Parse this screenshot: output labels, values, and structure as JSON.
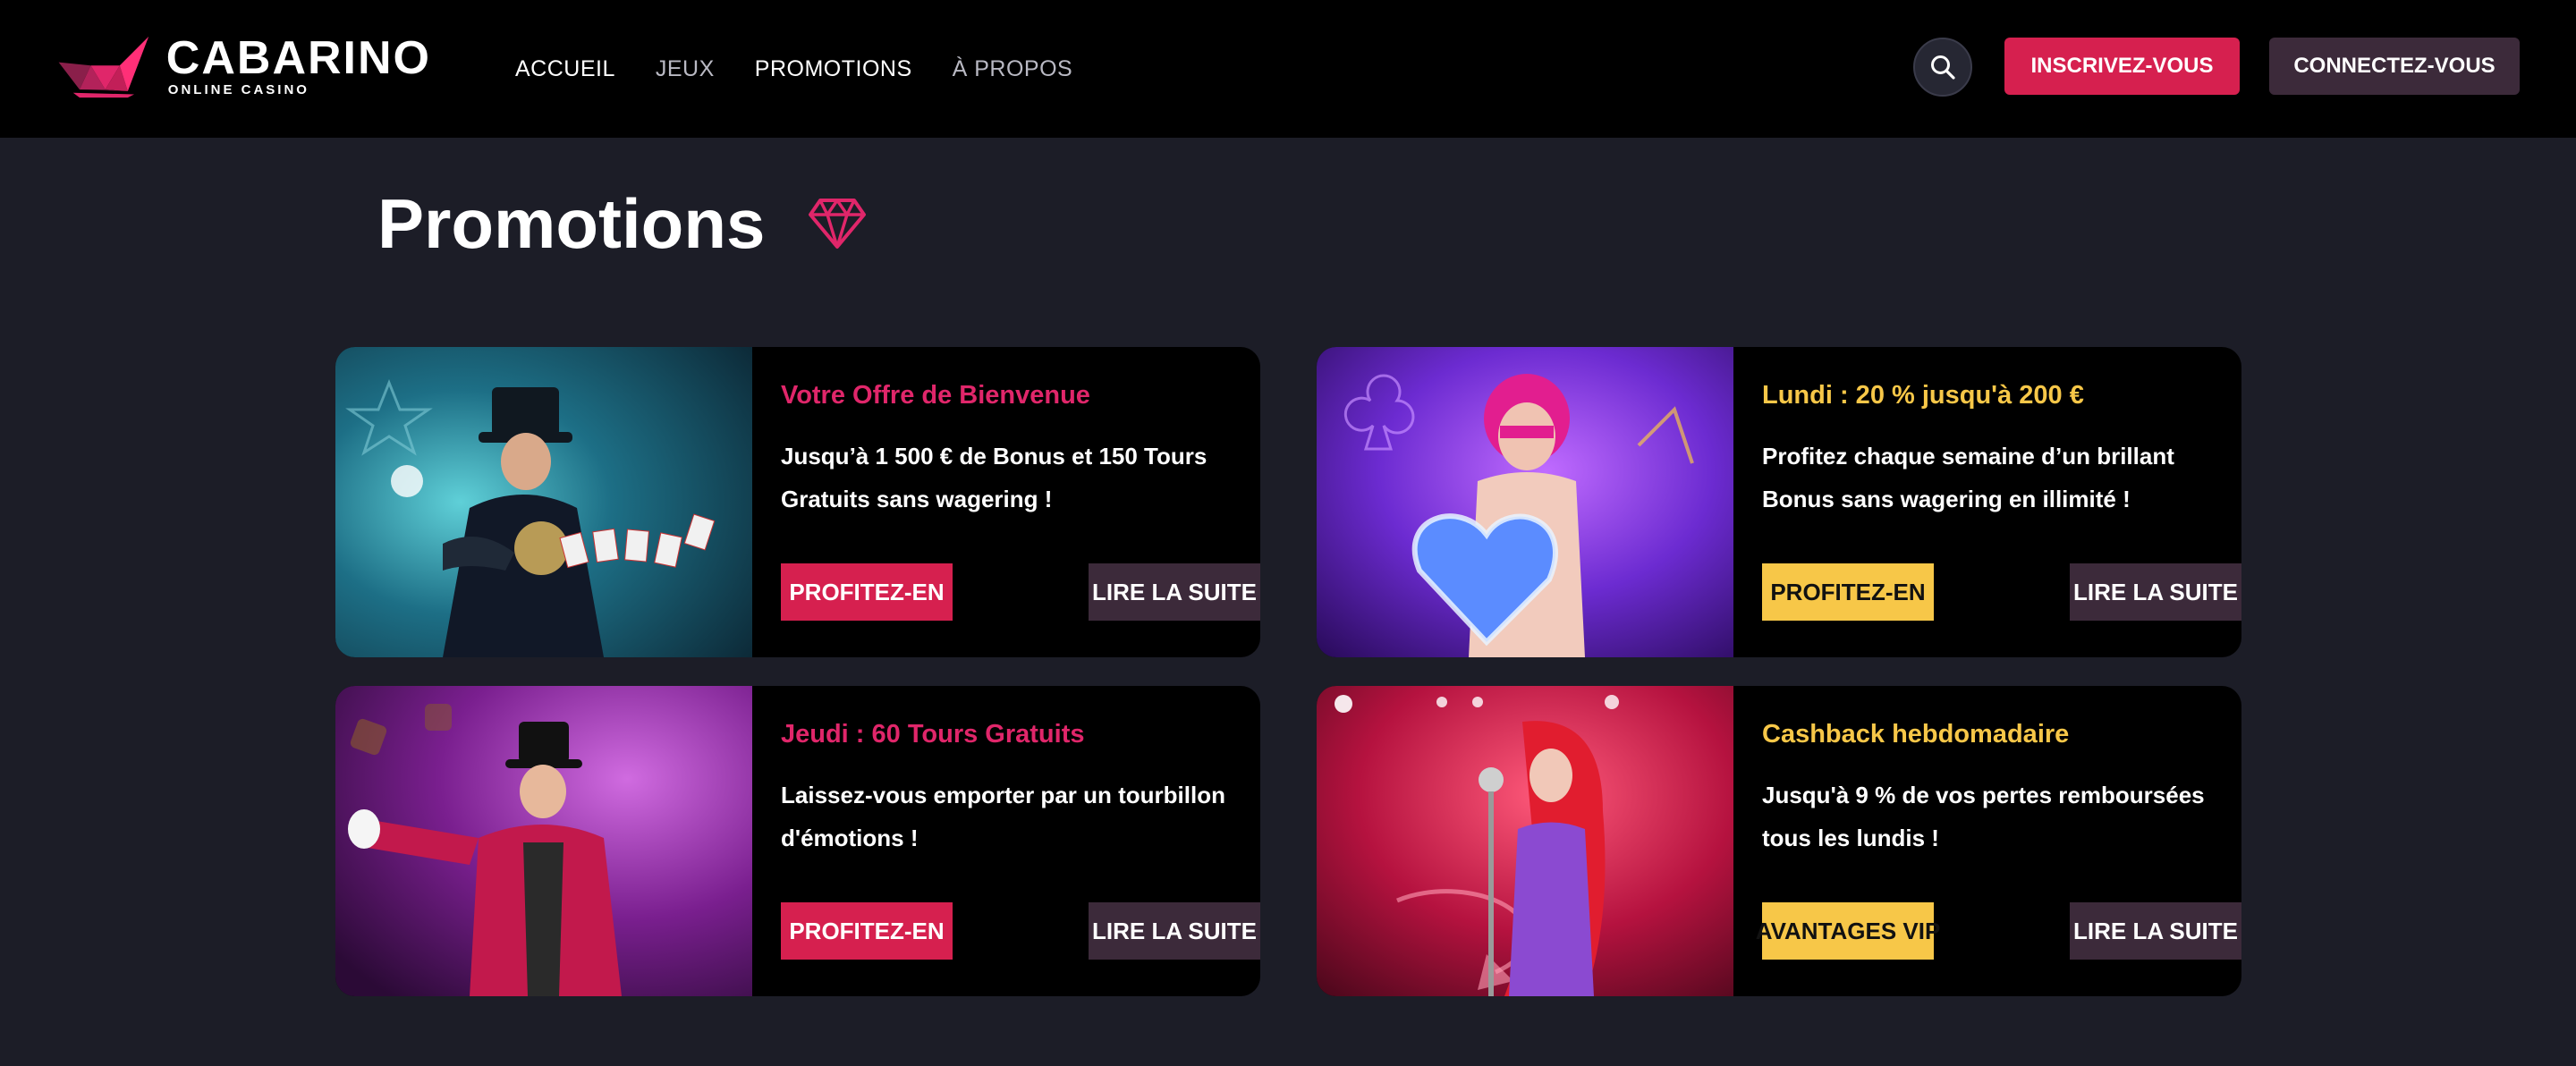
{
  "brand": {
    "name": "CABARINO",
    "tagline": "ONLINE CASINO"
  },
  "nav": {
    "items": [
      {
        "label": "ACCUEIL"
      },
      {
        "label": "JEUX"
      },
      {
        "label": "PROMOTIONS"
      },
      {
        "label": "À PROPOS"
      }
    ]
  },
  "header": {
    "register_label": "INSCRIVEZ-VOUS",
    "login_label": "CONNECTEZ-VOUS"
  },
  "page": {
    "title": "Promotions"
  },
  "colors": {
    "accent_pink": "#d6204f",
    "accent_yellow": "#f7c748",
    "secondary_button": "#3c2a3a",
    "background": "#1c1d27"
  },
  "promotions": [
    {
      "title": "Votre Offre de Bienvenue",
      "description": "Jusqu’à 1 500 € de Bonus et 150 Tours Gratuits sans wagering !",
      "cta_label": "PROFITEZ-EN",
      "more_label": "LIRE LA SUITE",
      "image": "magician-cards-image"
    },
    {
      "title": "Lundi : 20 % jusqu'à 200 €",
      "description": "Profitez chaque semaine d’un brillant Bonus sans wagering en illimité !",
      "cta_label": "PROFITEZ-EN",
      "more_label": "LIRE LA SUITE",
      "image": "woman-neon-heart-image"
    },
    {
      "title": "Jeudi : 60 Tours Gratuits",
      "description": "Laissez-vous emporter par un tourbillon d'émotions !",
      "cta_label": "PROFITEZ-EN",
      "more_label": "LIRE LA SUITE",
      "image": "ringmaster-image"
    },
    {
      "title": "Cashback hebdomadaire",
      "description": "Jusqu'à 9 % de vos pertes remboursées tous les lundis !",
      "cta_label": "AVANTAGES VIP",
      "more_label": "LIRE LA SUITE",
      "image": "singer-microphone-image"
    }
  ]
}
